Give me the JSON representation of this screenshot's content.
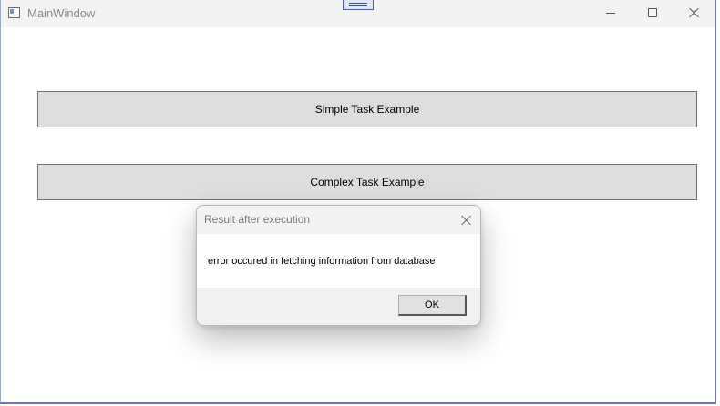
{
  "window": {
    "title": "MainWindow",
    "icons": {
      "app": "app-window-icon",
      "minimize": "minimize-icon",
      "maximize": "maximize-icon",
      "close": "close-icon"
    }
  },
  "main": {
    "simple_task_label": "Simple Task Example",
    "complex_task_label": "Complex Task Example"
  },
  "dialog": {
    "title": "Result after execution",
    "message": "error occured in fetching information from database",
    "ok_label": "OK",
    "close_icon": "close-icon"
  },
  "colors": {
    "button_face": "#dddddd",
    "button_border": "#707070",
    "titlebar": "#f3f3f3",
    "dialog_footer": "#f0f0f0",
    "window_border": "#6f79a3"
  }
}
